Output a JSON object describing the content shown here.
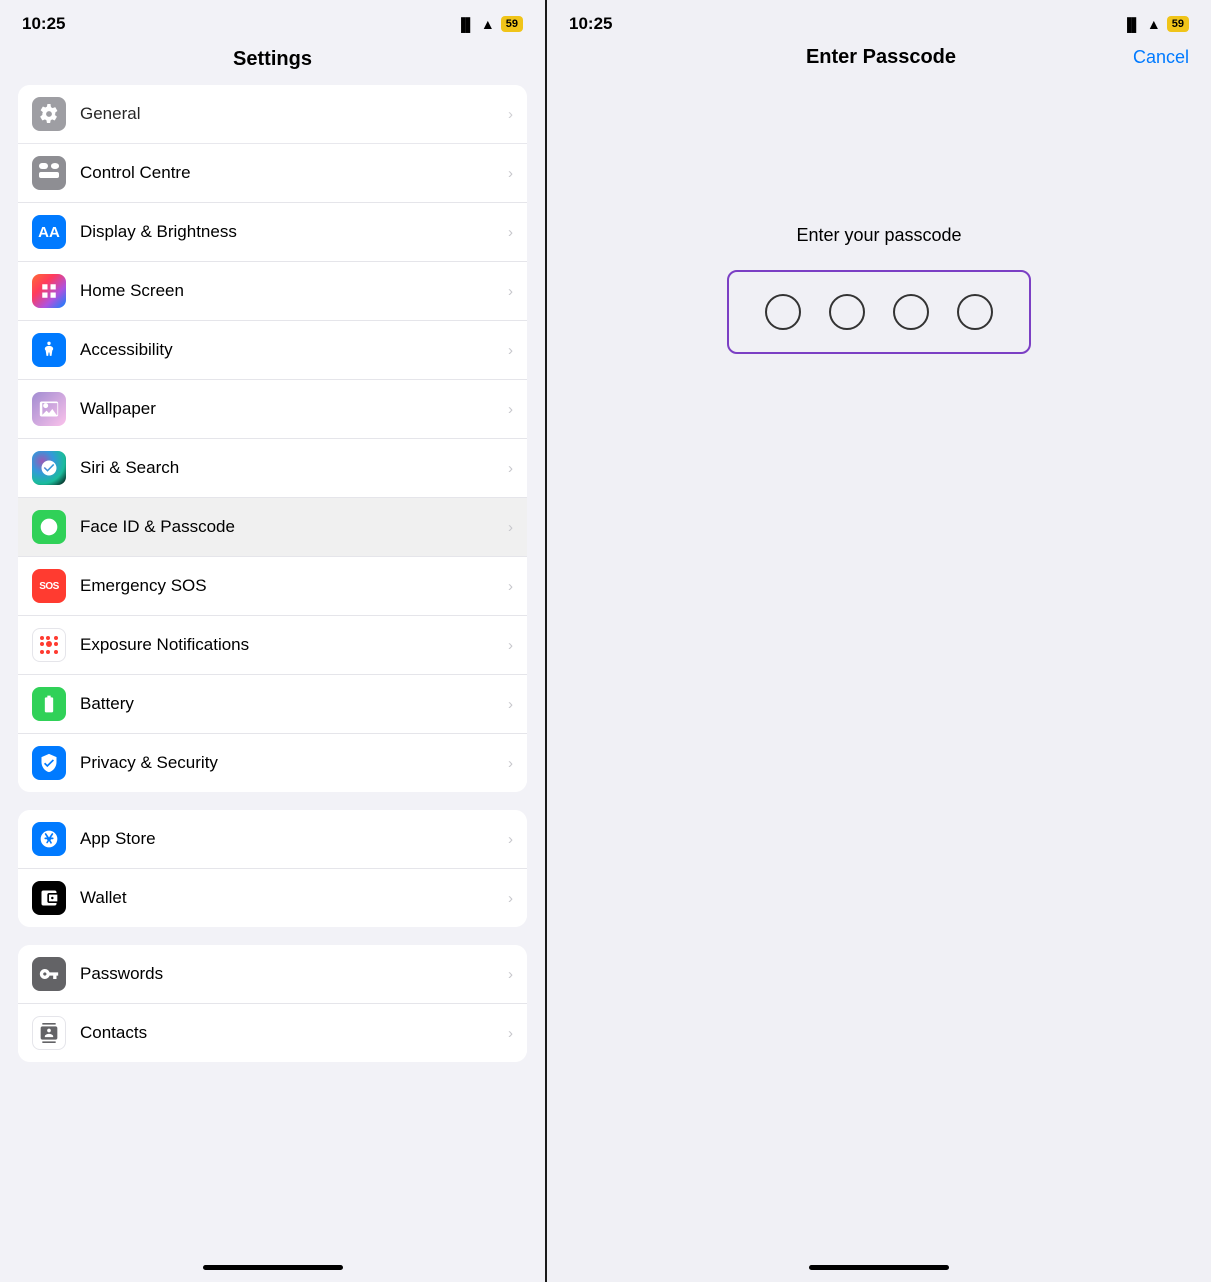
{
  "left": {
    "statusBar": {
      "time": "10:25",
      "battery": "59"
    },
    "title": "Settings",
    "groups": [
      {
        "id": "group1",
        "items": [
          {
            "id": "general",
            "label": "General",
            "iconBg": "icon-gray",
            "iconType": "gear"
          },
          {
            "id": "control-centre",
            "label": "Control Centre",
            "iconBg": "icon-gray",
            "iconType": "control"
          },
          {
            "id": "display-brightness",
            "label": "Display & Brightness",
            "iconBg": "icon-blue",
            "iconType": "aa"
          },
          {
            "id": "home-screen",
            "label": "Home Screen",
            "iconBg": "icon-blue-dark",
            "iconType": "grid"
          },
          {
            "id": "accessibility",
            "label": "Accessibility",
            "iconBg": "icon-blue",
            "iconType": "person"
          },
          {
            "id": "wallpaper",
            "label": "Wallpaper",
            "iconBg": "icon-wallpaper",
            "iconType": "wallpaper"
          },
          {
            "id": "siri-search",
            "label": "Siri & Search",
            "iconBg": "icon-siri",
            "iconType": "siri"
          },
          {
            "id": "face-id",
            "label": "Face ID & Passcode",
            "iconBg": "icon-green-face",
            "iconType": "faceid",
            "arrow": true
          },
          {
            "id": "emergency-sos",
            "label": "Emergency SOS",
            "iconBg": "icon-red",
            "iconType": "sos"
          },
          {
            "id": "exposure",
            "label": "Exposure Notifications",
            "iconBg": "icon-exposure",
            "iconType": "exposure"
          },
          {
            "id": "battery",
            "label": "Battery",
            "iconBg": "icon-battery",
            "iconType": "battery"
          },
          {
            "id": "privacy",
            "label": "Privacy & Security",
            "iconBg": "icon-privacy",
            "iconType": "hand"
          }
        ]
      },
      {
        "id": "group2",
        "items": [
          {
            "id": "appstore",
            "label": "App Store",
            "iconBg": "icon-appstore",
            "iconType": "appstore"
          },
          {
            "id": "wallet",
            "label": "Wallet",
            "iconBg": "icon-wallet",
            "iconType": "wallet"
          }
        ]
      },
      {
        "id": "group3",
        "items": [
          {
            "id": "passwords",
            "label": "Passwords",
            "iconBg": "icon-passwords",
            "iconType": "key"
          },
          {
            "id": "contacts",
            "label": "Contacts",
            "iconBg": "icon-contacts",
            "iconType": "contacts"
          }
        ]
      }
    ]
  },
  "right": {
    "statusBar": {
      "time": "10:25",
      "battery": "59"
    },
    "title": "Enter Passcode",
    "cancelLabel": "Cancel",
    "prompt": "Enter your passcode",
    "circles": 4
  }
}
